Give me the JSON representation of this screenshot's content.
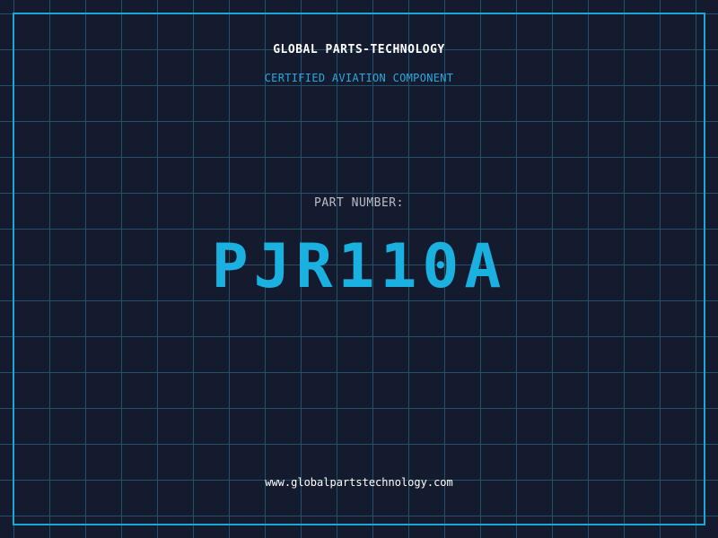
{
  "header": {
    "company": "GLOBAL PARTS-TECHNOLOGY",
    "tagline": "CERTIFIED AVIATION COMPONENT"
  },
  "part": {
    "label": "PART NUMBER:",
    "number": "PJR110A"
  },
  "footer": {
    "website": "www.globalpartstechnology.com"
  },
  "colors": {
    "background": "#141b2e",
    "grid": "#22506a",
    "accent": "#1ab0e0",
    "frame": "#1aa7d8"
  }
}
